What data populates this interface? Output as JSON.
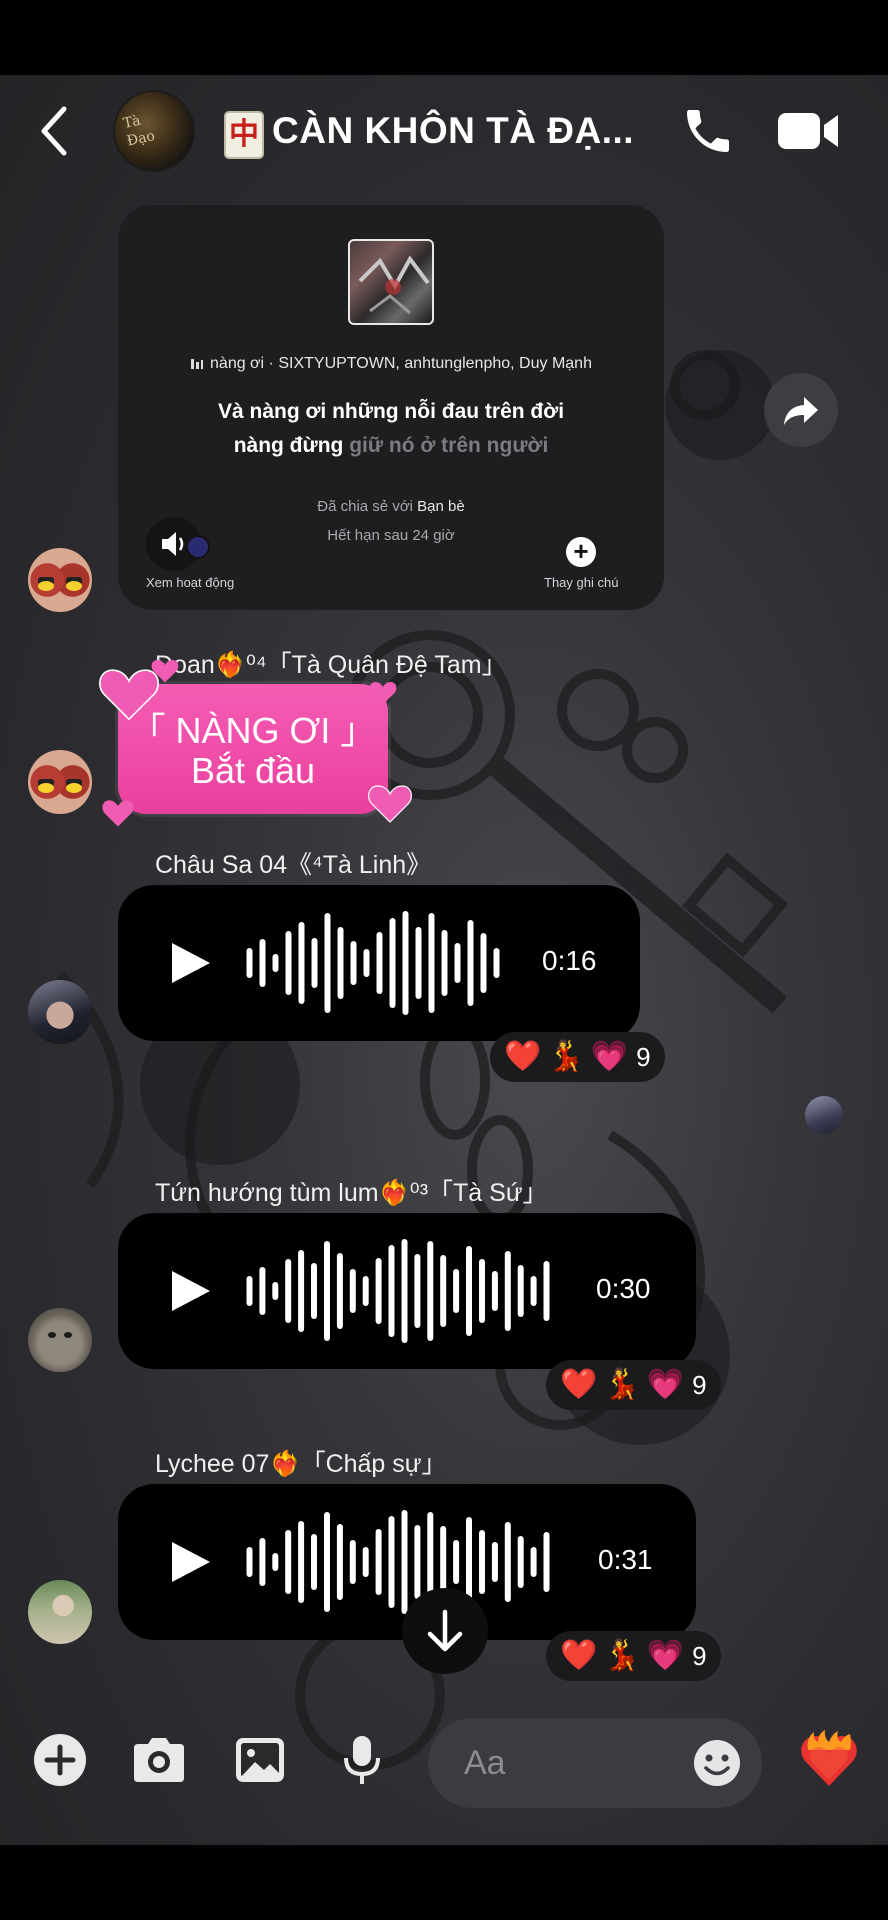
{
  "header": {
    "back_icon": "chevron-left-icon",
    "group_avatar_text": "Tà\nĐạo",
    "mahjong_icon": "🀄",
    "mahjong_glyph": "中",
    "title": "CÀN KHÔN TÀ ĐẠ...",
    "call_icon": "phone-icon",
    "video_icon": "video-camera-icon"
  },
  "note": {
    "song_name": "nàng ơi",
    "song_separator": " · ",
    "song_artists": "SIXTYUPTOWN, anhtunglenpho, Duy Mạnh",
    "lyric_line1": "Và nàng ơi những nỗi đau trên đời",
    "lyric_line2_bright": "nàng đừng",
    "lyric_line2_dim": " giữ nó ở trên người",
    "shared_prefix": "Đã chia sẻ với ",
    "shared_with": "Bạn bè",
    "expire": "Hết hạn sau 24 giờ",
    "view_activity": "Xem hoạt động",
    "change_note": "Thay ghi chú",
    "add_symbol": "+"
  },
  "messages": [
    {
      "sender": "Đoan❤️‍🔥⁰⁴「Tà Quân Đệ Tam」",
      "type": "sticker",
      "sticker_line1": "「 NÀNG ƠI 」",
      "sticker_line2": "Bắt đầu"
    },
    {
      "sender": "Châu Sa 04《⁴Tà Linh》",
      "type": "voice",
      "duration": "0:16",
      "reactions": [
        "❤️",
        "💃",
        "💗"
      ],
      "reaction_count": "9"
    },
    {
      "sender": "Tứn hướng tùm lum❤️‍🔥⁰³「Tà Sứ」",
      "type": "voice",
      "duration": "0:30",
      "reactions": [
        "❤️",
        "💃",
        "💗"
      ],
      "reaction_count": "9"
    },
    {
      "sender": "Lychee 07❤️‍🔥「Chấp sự」",
      "type": "voice",
      "duration": "0:31",
      "reactions": [
        "❤️",
        "💃",
        "💗"
      ],
      "reaction_count": "9"
    }
  ],
  "composer": {
    "placeholder": "Aa",
    "add_icon": "plus-circle-icon",
    "camera_icon": "camera-icon",
    "gallery_icon": "image-icon",
    "mic_icon": "microphone-icon",
    "emoji_icon": "smiley-icon",
    "quick_reaction": "❤️‍🔥"
  },
  "colors": {
    "background": "#2c2c30",
    "bubble": "#000000",
    "sticker_pink": "#ee4aa6",
    "note_card": "#1e1e20"
  }
}
